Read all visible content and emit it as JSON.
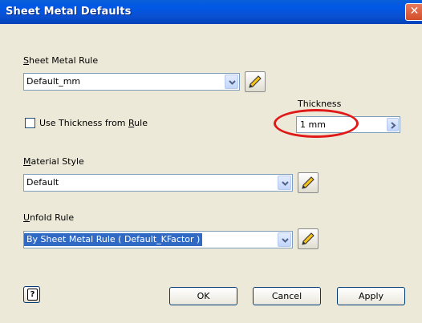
{
  "window": {
    "title": "Sheet Metal Defaults",
    "close_glyph": "✕"
  },
  "sheet_metal_rule": {
    "label_u": "S",
    "label_rest": "heet Metal Rule",
    "value": "Default_mm"
  },
  "thickness": {
    "label": "Thickness",
    "value": "1 mm"
  },
  "use_thickness": {
    "label_before": "Use Thickness from ",
    "label_u": "R",
    "label_after": "ule",
    "checked": false
  },
  "material_style": {
    "label_u": "M",
    "label_rest": "aterial Style",
    "value": "Default"
  },
  "unfold_rule": {
    "label_u": "U",
    "label_rest": "nfold Rule",
    "value": "By Sheet Metal Rule ( Default_KFactor )"
  },
  "buttons": {
    "help_glyph": "?",
    "ok": "OK",
    "cancel": "Cancel",
    "apply": "Apply"
  },
  "icons": [
    "pencil-icon",
    "chevron-down-icon",
    "chevron-right-icon",
    "help-icon",
    "close-icon"
  ],
  "colors": {
    "titlebar": "#0058e6",
    "selection": "#316ac5",
    "highlight_ring": "#e01818",
    "dialog_bg": "#ece9d8"
  }
}
